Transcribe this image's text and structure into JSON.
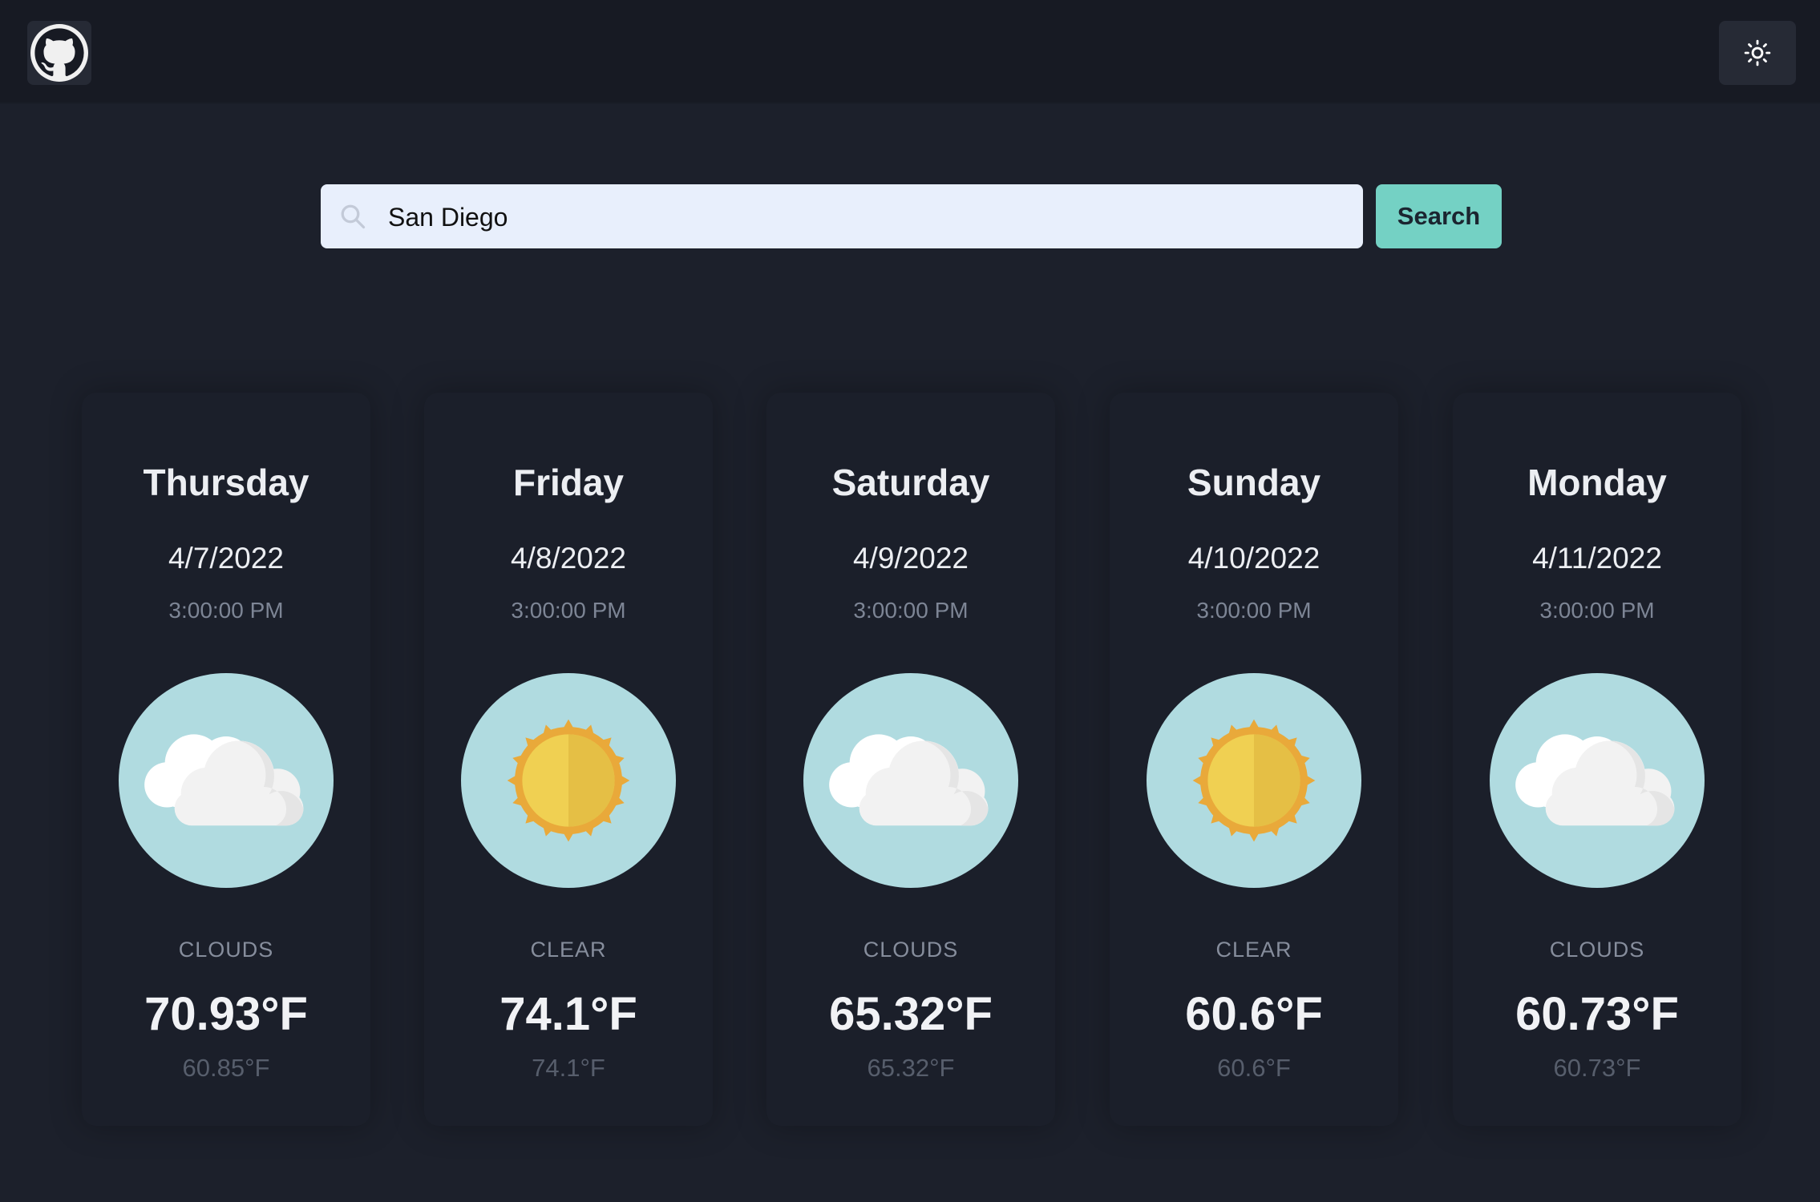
{
  "header": {
    "logo_icon": "github-icon",
    "theme_toggle_icon": "sun-icon"
  },
  "search": {
    "value": "San Diego",
    "placeholder": "",
    "button_label": "Search",
    "icon": "search-icon",
    "button_color": "#74d1c4"
  },
  "forecast": [
    {
      "day": "Thursday",
      "date": "4/7/2022",
      "time": "3:00:00 PM",
      "condition": "CLOUDS",
      "icon": "clouds-icon",
      "temp": "70.93°F",
      "feels_like": "60.85°F"
    },
    {
      "day": "Friday",
      "date": "4/8/2022",
      "time": "3:00:00 PM",
      "condition": "CLEAR",
      "icon": "sun-icon",
      "temp": "74.1°F",
      "feels_like": "74.1°F"
    },
    {
      "day": "Saturday",
      "date": "4/9/2022",
      "time": "3:00:00 PM",
      "condition": "CLOUDS",
      "icon": "clouds-icon",
      "temp": "65.32°F",
      "feels_like": "65.32°F"
    },
    {
      "day": "Sunday",
      "date": "4/10/2022",
      "time": "3:00:00 PM",
      "condition": "CLEAR",
      "icon": "sun-icon",
      "temp": "60.6°F",
      "feels_like": "60.6°F"
    },
    {
      "day": "Monday",
      "date": "4/11/2022",
      "time": "3:00:00 PM",
      "condition": "CLOUDS",
      "icon": "clouds-icon",
      "temp": "60.73°F",
      "feels_like": "60.73°F"
    }
  ],
  "colors": {
    "background": "#1c202b",
    "header": "#171a23",
    "card": "#1b1f2a",
    "icon_circle": "#b0dbe0"
  }
}
